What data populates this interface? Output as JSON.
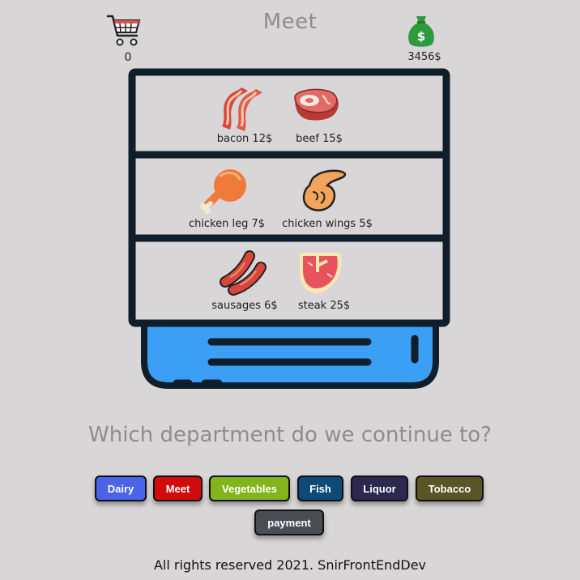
{
  "header": {
    "title": "Meet",
    "cart_count": "0",
    "balance": "3456$",
    "cart_icon": "shopping-cart-icon",
    "money_icon": "money-bag-icon"
  },
  "shelves": [
    {
      "items": [
        {
          "label": "bacon 12$",
          "icon": "bacon-icon"
        },
        {
          "label": "beef 15$",
          "icon": "beef-icon"
        }
      ]
    },
    {
      "items": [
        {
          "label": "chicken leg 7$",
          "icon": "chicken-leg-icon"
        },
        {
          "label": "chicken wings 5$",
          "icon": "chicken-wings-icon"
        }
      ]
    },
    {
      "items": [
        {
          "label": "sausages 6$",
          "icon": "sausages-icon"
        },
        {
          "label": "steak 25$",
          "icon": "steak-icon"
        }
      ]
    }
  ],
  "question": "Which department do we continue to?",
  "departments": [
    {
      "label": "Dairy",
      "color": "#4a63e8"
    },
    {
      "label": "Meet",
      "color": "#d10a0a"
    },
    {
      "label": "Vegetables",
      "color": "#82b51c"
    },
    {
      "label": "Fish",
      "color": "#0d4a78"
    },
    {
      "label": "Liquor",
      "color": "#2c2850"
    },
    {
      "label": "Tobacco",
      "color": "#5a5526"
    }
  ],
  "payment": {
    "label": "payment",
    "color": "#4a4e54"
  },
  "footer": "All rights reserved 2021. SnirFrontEndDev"
}
